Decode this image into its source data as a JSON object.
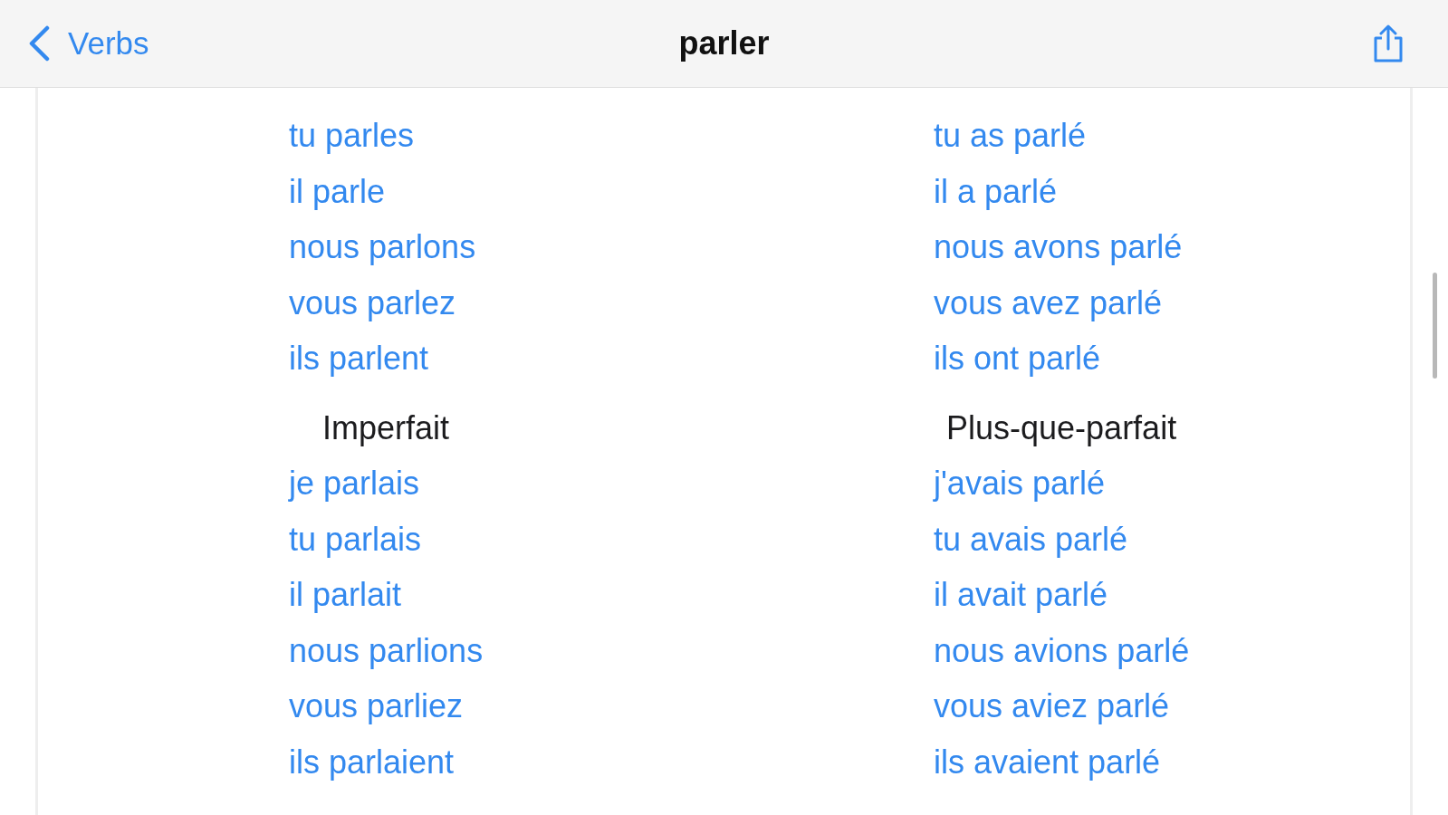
{
  "nav_bar": {
    "back_button": "Verbs",
    "title": "parler"
  },
  "tense_rows": [
    {
      "tenses": [
        {
          "forms": [
            "tu parles",
            "il parle",
            "nous parlons",
            "vous parlez",
            "ils parlent"
          ]
        },
        {
          "forms": [
            "tu as parlé",
            "il a parlé",
            "nous avons parlé",
            "vous avez parlé",
            "ils ont parlé"
          ]
        }
      ]
    },
    {
      "tenses": [
        {
          "heading": "Imperfait",
          "forms": [
            "je parlais",
            "tu parlais",
            "il parlait",
            "nous parlions",
            "vous parliez",
            "ils parlaient"
          ]
        },
        {
          "heading": "Plus-que-parfait",
          "forms": [
            "j'avais parlé",
            "tu avais parlé",
            "il avait parlé",
            "nous avions parlé",
            "vous aviez parlé",
            "ils avaient parlé"
          ]
        }
      ]
    }
  ]
}
